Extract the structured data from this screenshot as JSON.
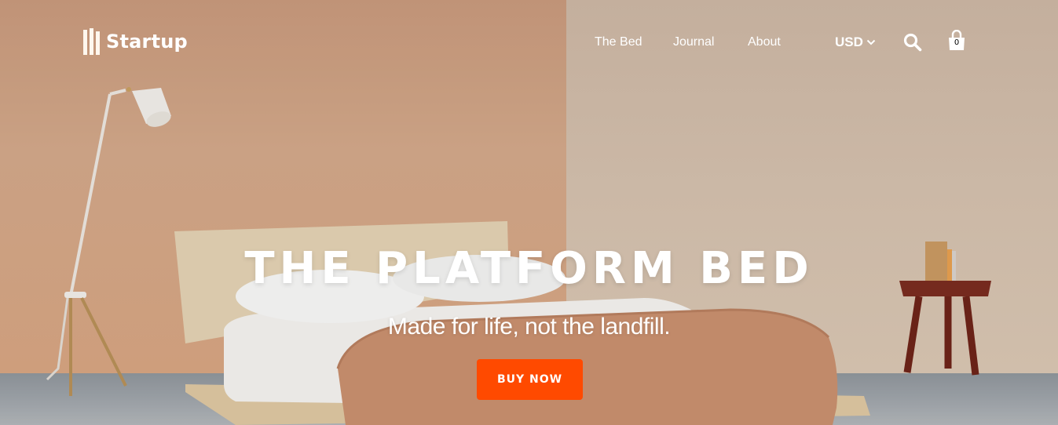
{
  "brand": {
    "name": "Startup",
    "logo_icon": "bars-logo-icon"
  },
  "nav": {
    "links": [
      {
        "label": "The Bed"
      },
      {
        "label": "Journal"
      },
      {
        "label": "About"
      }
    ],
    "currency": {
      "label": "USD",
      "icon": "chevron-down-icon"
    },
    "search": {
      "icon": "search-icon"
    },
    "cart": {
      "icon": "shopping-bag-icon",
      "count": "0"
    }
  },
  "hero": {
    "title": "THE PLATFORM BED",
    "subtitle": "Made for life, not the landfill.",
    "cta_label": "BUY NOW",
    "cta_color": "#ff4a00"
  },
  "colors": {
    "wall_left": "#d3a88a",
    "wall_right": "#d4c0ad",
    "floor": "#a3a8ad",
    "text": "#ffffff"
  }
}
